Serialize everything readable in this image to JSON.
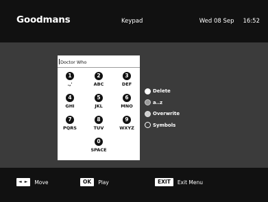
{
  "header": {
    "brand": "Goodmans",
    "title": "Keypad",
    "date": "Wed 08 Sep",
    "time": "16:52"
  },
  "keypad": {
    "entry_text": "Doctor Who",
    "keys": [
      {
        "num": "1",
        "letters": ".,'"
      },
      {
        "num": "2",
        "letters": "ABC"
      },
      {
        "num": "3",
        "letters": "DEF"
      },
      {
        "num": "4",
        "letters": "GHI"
      },
      {
        "num": "5",
        "letters": "JKL"
      },
      {
        "num": "6",
        "letters": "MNO"
      },
      {
        "num": "7",
        "letters": "PQRS"
      },
      {
        "num": "8",
        "letters": "TUV"
      },
      {
        "num": "9",
        "letters": "WXYZ"
      },
      {
        "num": "0",
        "letters": "SPACE"
      }
    ]
  },
  "options": [
    {
      "label": "Delete",
      "color": "#ffffff",
      "icon": "white-circle-icon"
    },
    {
      "label": "a..z",
      "color": "#9b9b9b",
      "icon": "grey-circle-icon"
    },
    {
      "label": "Overwrite",
      "color": "#cfcfcf",
      "icon": "lightgrey-circle-icon"
    },
    {
      "label": "Symbols",
      "color": "#3b3b3b",
      "icon": "outline-circle-icon"
    }
  ],
  "footer": {
    "move_key": "◄ ►",
    "move_label": "Move",
    "ok_key": "OK",
    "ok_label": "Play",
    "exit_key": "EXIT",
    "exit_label": "Exit Menu"
  }
}
